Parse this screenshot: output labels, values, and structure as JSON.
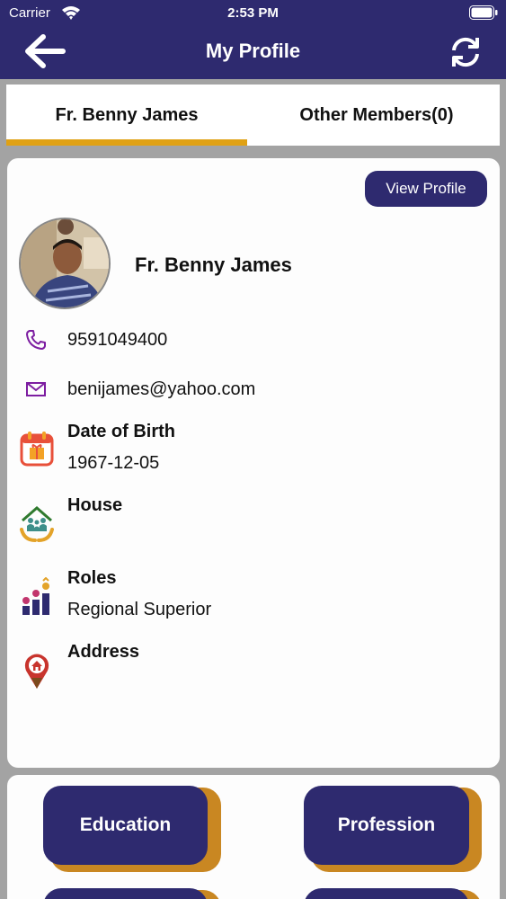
{
  "status_bar": {
    "carrier": "Carrier",
    "time": "2:53 PM"
  },
  "header": {
    "title": "My Profile",
    "back_icon": "back-arrow-icon",
    "refresh_icon": "refresh-icon"
  },
  "tabs": [
    {
      "label": "Fr. Benny James",
      "active": true
    },
    {
      "label": "Other Members(0)",
      "active": false
    }
  ],
  "profile": {
    "view_profile_label": "View Profile",
    "name": "Fr. Benny James",
    "phone": "9591049400",
    "email": "benijames@yahoo.com",
    "dob_label": "Date of Birth",
    "dob": "1967-12-05",
    "house_label": "House",
    "house": "",
    "roles_label": "Roles",
    "roles": "Regional Superior",
    "address_label": "Address",
    "address": ""
  },
  "sections": {
    "education_label": "Education",
    "profession_label": "Profession"
  },
  "colors": {
    "primary": "#2e2a6f",
    "accent": "#e0a114",
    "button_shadow": "#c98722",
    "background": "#a3a3a3"
  }
}
